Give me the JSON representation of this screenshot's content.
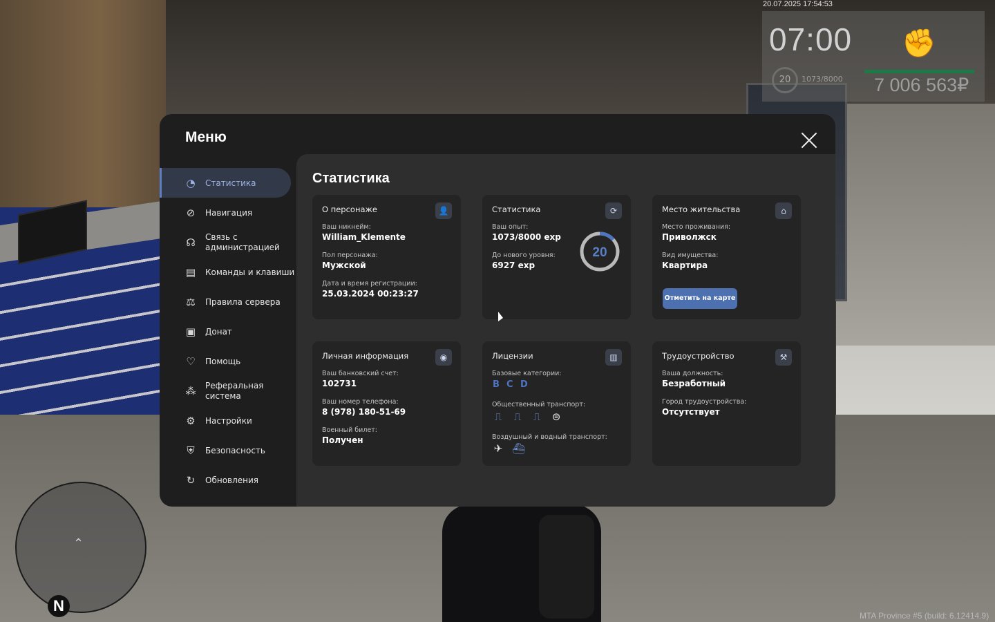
{
  "hud": {
    "datetime": "20.07.2025 17:54:53",
    "time": "07:00",
    "level": "20",
    "exp": "1073/8000",
    "money": "7 006 563₽",
    "build": "MTA Province #5 (build: 6.12414.9)",
    "compass": "N"
  },
  "menu": {
    "title": "Меню",
    "nav": [
      {
        "label": "Статистика",
        "icon": "pie-chart-icon",
        "active": true
      },
      {
        "label": "Навигация",
        "icon": "compass-icon"
      },
      {
        "label": "Связь с администрацией",
        "icon": "headset-icon"
      },
      {
        "label": "Команды и клавиши",
        "icon": "document-icon"
      },
      {
        "label": "Правила сервера",
        "icon": "scales-icon"
      },
      {
        "label": "Донат",
        "icon": "wallet-icon"
      },
      {
        "label": "Помощь",
        "icon": "heart-hand-icon"
      },
      {
        "label": "Реферальная система",
        "icon": "network-icon"
      },
      {
        "label": "Настройки",
        "icon": "gear-icon"
      },
      {
        "label": "Безопасность",
        "icon": "shield-icon"
      },
      {
        "label": "Обновления",
        "icon": "refresh-check-icon"
      }
    ]
  },
  "content": {
    "title": "Статистика",
    "character": {
      "title": "О персонаже",
      "nickname_label": "Ваш никнейм:",
      "nickname": "William_Klemente",
      "gender_label": "Пол персонажа:",
      "gender": "Мужской",
      "reg_label": "Дата и время регистрации:",
      "reg": "25.03.2024 00:23:27"
    },
    "stats": {
      "title": "Статистика",
      "exp_label": "Ваш опыт:",
      "exp": "1073/8000 exp",
      "next_label": "До нового уровня:",
      "next": "6927 exp",
      "level": "20",
      "progress": 0.134
    },
    "residence": {
      "title": "Место жительства",
      "place_label": "Место проживания:",
      "place": "Приволжск",
      "property_label": "Вид имущества:",
      "property": "Квартира",
      "button": "Отметить на карте"
    },
    "personal": {
      "title": "Личная информация",
      "bank_label": "Ваш банковский счет:",
      "bank": "102731",
      "phone_label": "Ваш номер телефона:",
      "phone": "8 (978) 180-51-69",
      "military_label": "Военный билет:",
      "military": "Получен"
    },
    "licenses": {
      "title": "Лицензии",
      "base_label": "Базовые категории:",
      "categories": [
        "B",
        "C",
        "D"
      ],
      "public_label": "Общественный транспорт:",
      "public_icons": [
        "trolleybus-icon",
        "bus-icon",
        "tram-icon",
        "metro-icon"
      ],
      "air_label": "Воздушный и водный транспорт:",
      "air_icons": [
        "plane-icon",
        "boat-icon"
      ]
    },
    "employment": {
      "title": "Трудоустройство",
      "position_label": "Ваша должность:",
      "position": "Безработный",
      "city_label": "Город трудоустройства:",
      "city": "Отсутствует"
    }
  }
}
